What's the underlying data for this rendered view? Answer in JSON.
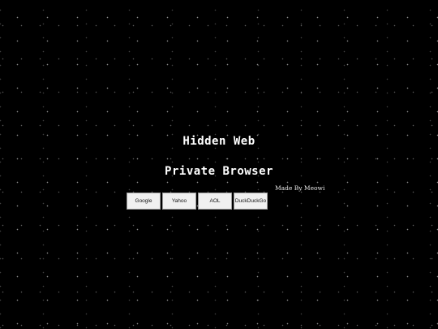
{
  "header": {
    "title": "Hidden Web",
    "subtitle": "Private Browser"
  },
  "credit": "Made By Meowi",
  "search_engines": [
    {
      "label": "Google"
    },
    {
      "label": "Yahoo"
    },
    {
      "label": "AOL"
    },
    {
      "label": "DuckDuckGo"
    }
  ],
  "colors": {
    "background": "#000000",
    "text": "#ffffff",
    "button_bg": "#f0f0f0"
  }
}
